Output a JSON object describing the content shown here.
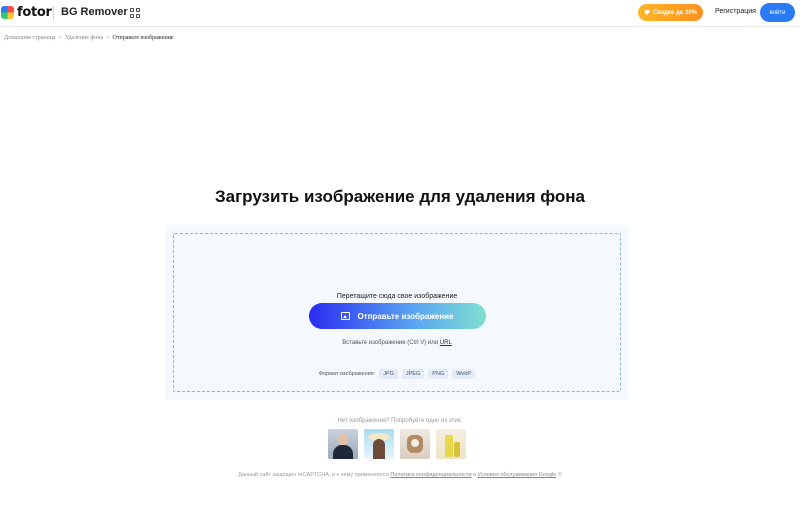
{
  "header": {
    "logo_text": "fotor",
    "product_name": "BG Remover",
    "promo_label": "Скидка до 20%",
    "register_label": "Регистрация",
    "login_label": "войти"
  },
  "breadcrumb": {
    "items": [
      "Домашняя страница",
      "Удаление фона",
      "Отправьте изображение"
    ],
    "separator": ">"
  },
  "main": {
    "title": "Загрузить изображение для удаления фона",
    "drop_text": "Перетащите сюда свое изображение",
    "upload_button_label": "Отправьте изображение",
    "paste_text": "Вставьте изображение (Ctrl V) или",
    "url_link": "URL",
    "formats_label": "Формат изображения:",
    "formats": [
      "JPG",
      "JPEG",
      "PNG",
      "WebP"
    ]
  },
  "samples": {
    "caption": "Нет изображения? Попробуйте одно из этих:"
  },
  "footer": {
    "recaptcha_text": "Данный сайт защищен reCAPTCHA, и к нему применяются",
    "privacy_link": "Политика конфиденциальности",
    "and_text": "и",
    "terms_link": "Условия обслуживания Google",
    "terms_suffix": "©"
  },
  "colors": {
    "primary_blue": "#2a7af3",
    "promo_orange": "#ffb627",
    "dropzone_border": "#8fb3e3",
    "upload_gradient_start": "#2a2cf0",
    "upload_gradient_end": "#7fe0d0"
  }
}
